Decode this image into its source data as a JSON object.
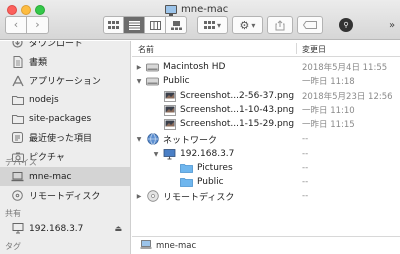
{
  "window": {
    "title": "mne-mac"
  },
  "toolbar": {
    "back_icon": "chevron-left-icon",
    "forward_icon": "chevron-right-icon",
    "views": [
      {
        "name": "icon-view",
        "active": false
      },
      {
        "name": "list-view",
        "active": true
      },
      {
        "name": "column-view",
        "active": false
      },
      {
        "name": "gallery-view",
        "active": false
      }
    ],
    "overflow_label": "»"
  },
  "sidebar": {
    "items_top": [
      {
        "label": "ダウンロード",
        "icon": "download-icon"
      },
      {
        "label": "書類",
        "icon": "document-icon"
      },
      {
        "label": "アプリケーション",
        "icon": "applications-icon"
      },
      {
        "label": "nodejs",
        "icon": "folder-icon"
      },
      {
        "label": "site-packages",
        "icon": "folder-icon"
      },
      {
        "label": "最近使った項目",
        "icon": "recents-icon"
      },
      {
        "label": "ピクチャ",
        "icon": "camera-icon"
      }
    ],
    "devices_header": "デバイス",
    "devices": [
      {
        "label": "mne-mac",
        "icon": "laptop-icon",
        "selected": true
      },
      {
        "label": "リモートディスク",
        "icon": "optical-disc-icon",
        "selected": false
      }
    ],
    "shared_header": "共有",
    "shared": [
      {
        "label": "192.168.3.7",
        "icon": "network-server-icon"
      }
    ],
    "tags_header": "タグ"
  },
  "columns": {
    "name": "名前",
    "date": "変更日"
  },
  "rows": [
    {
      "name": "Macintosh HD",
      "date": "2018年5月4日 11:55",
      "icon": "hard-drive-icon",
      "expanded": false,
      "depth": 0
    },
    {
      "name": "Public",
      "date": "一昨日 11:18",
      "icon": "hard-drive-icon",
      "expanded": true,
      "depth": 0
    },
    {
      "name": "Screenshot...2-56-37.png",
      "date": "2018年5月23日 12:56",
      "icon": "image-file-icon",
      "depth": 1
    },
    {
      "name": "Screenshot...1-10-43.png",
      "date": "一昨日 11:10",
      "icon": "image-file-icon",
      "depth": 1
    },
    {
      "name": "Screenshot...1-15-29.png",
      "date": "一昨日 11:15",
      "icon": "image-file-icon",
      "depth": 1
    },
    {
      "name": "ネットワーク",
      "date": "--",
      "icon": "network-globe-icon",
      "expanded": true,
      "depth": 0
    },
    {
      "name": "192.168.3.7",
      "date": "--",
      "icon": "network-server-icon",
      "expanded": true,
      "depth": 1
    },
    {
      "name": "Pictures",
      "date": "--",
      "icon": "shared-folder-icon",
      "depth": 2
    },
    {
      "name": "Public",
      "date": "--",
      "icon": "shared-folder-icon",
      "depth": 2
    },
    {
      "name": "リモートディスク",
      "date": "--",
      "icon": "optical-disc-icon",
      "expanded": false,
      "depth": 0
    }
  ],
  "pathbar": {
    "label": "mne-mac",
    "icon": "laptop-icon"
  }
}
